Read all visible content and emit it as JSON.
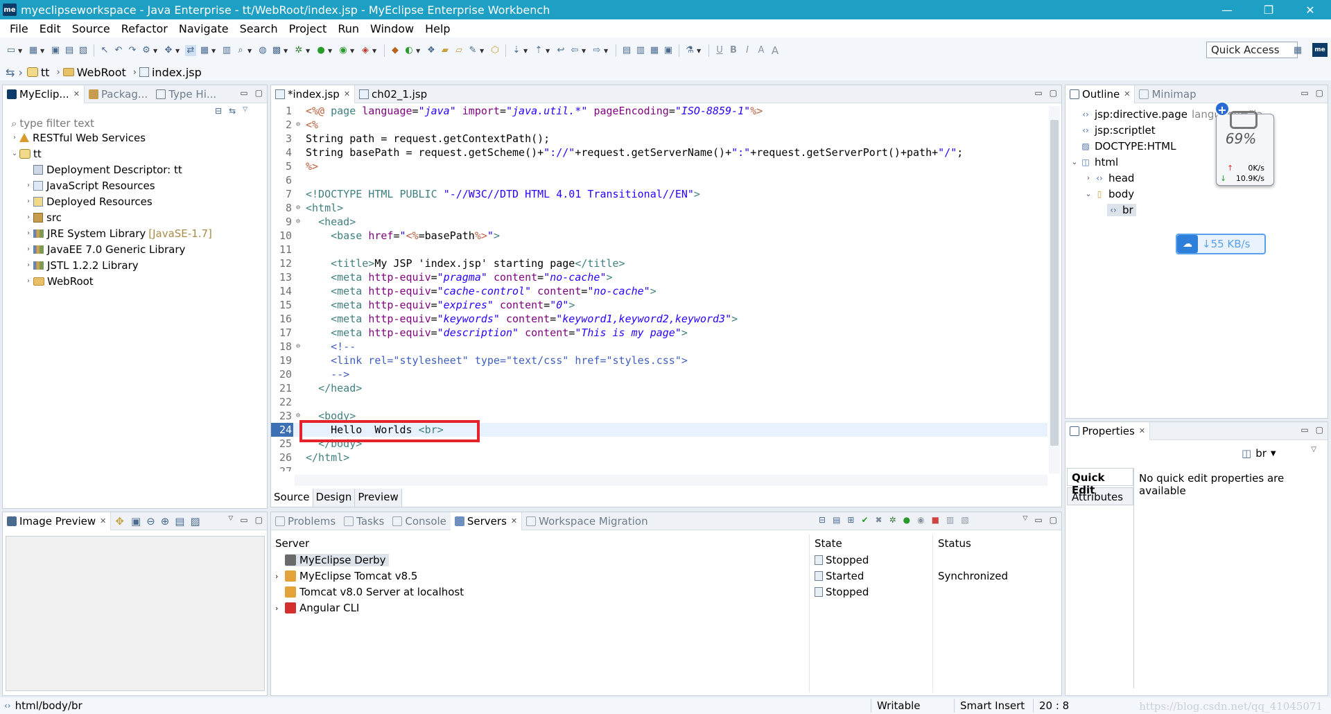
{
  "window": {
    "logo": "me",
    "title": "myeclipseworkspace - Java Enterprise - tt/WebRoot/index.jsp - MyEclipse Enterprise Workbench",
    "minimize": "—",
    "maximize": "❐",
    "close": "✕"
  },
  "menu": [
    "File",
    "Edit",
    "Source",
    "Refactor",
    "Navigate",
    "Search",
    "Project",
    "Run",
    "Window",
    "Help"
  ],
  "toolbar": {
    "quick_access": "Quick Access",
    "perspective": "me",
    "format_letters": [
      "U",
      "B",
      "I",
      "A",
      "A"
    ]
  },
  "breadcrumb": {
    "items": [
      "tt",
      "WebRoot",
      "index.jsp"
    ]
  },
  "explorer": {
    "tabs": [
      "MyEclip...",
      "Packag...",
      "Type Hi..."
    ],
    "filter_placeholder": "type filter text",
    "tree": [
      {
        "label": "RESTful Web Services",
        "icon": "warning-icon",
        "depth": 0,
        "expanded": false
      },
      {
        "label": "tt",
        "icon": "project-icon",
        "depth": 0,
        "expanded": true
      },
      {
        "label": "Deployment Descriptor: tt",
        "icon": "descriptor-icon",
        "depth": 1,
        "expanded": null
      },
      {
        "label": "JavaScript Resources",
        "icon": "js-resources-icon",
        "depth": 1,
        "expanded": false
      },
      {
        "label": "Deployed Resources",
        "icon": "deployed-icon",
        "depth": 1,
        "expanded": false
      },
      {
        "label": "src",
        "icon": "package-icon",
        "depth": 1,
        "expanded": false
      },
      {
        "label": "JRE System Library",
        "suffix": "[JavaSE-1.7]",
        "icon": "library-icon",
        "depth": 1,
        "expanded": false
      },
      {
        "label": "JavaEE 7.0 Generic Library",
        "icon": "library-icon",
        "depth": 1,
        "expanded": false
      },
      {
        "label": "JSTL 1.2.2 Library",
        "icon": "library-icon",
        "depth": 1,
        "expanded": false
      },
      {
        "label": "WebRoot",
        "icon": "folder-icon",
        "depth": 1,
        "expanded": false
      }
    ]
  },
  "editor": {
    "tabs": [
      "*index.jsp",
      "ch02_1.jsp"
    ],
    "current_line": 24,
    "lines": [
      {
        "n": "1",
        "fold": "",
        "html": "<span class='k-jsp'>&lt;%@</span> <span class='k-tag'>page</span> <span class='k-attr'>language</span>=<span class='k-val'>\"java\"</span> <span class='k-attr'>import</span>=<span class='k-val'>\"java.util.*\"</span> <span class='k-attr'>pageEncoding</span>=<span class='k-val'>\"ISO-8859-1\"</span><span class='k-jsp'>%&gt;</span>"
      },
      {
        "n": "2",
        "fold": "⊖",
        "html": "<span class='k-jsp'>&lt;%</span>"
      },
      {
        "n": "3",
        "fold": "",
        "html": "String path = request.getContextPath();"
      },
      {
        "n": "4",
        "fold": "",
        "html": "String basePath = request.getScheme()+<span class='k-str'>\"://\"</span>+request.getServerName()+<span class='k-str'>\":\"</span>+request.getServerPort()+path+<span class='k-str'>\"/\"</span>;"
      },
      {
        "n": "5",
        "fold": "",
        "html": "<span class='k-jsp'>%&gt;</span>"
      },
      {
        "n": "6",
        "fold": "",
        "html": ""
      },
      {
        "n": "7",
        "fold": "",
        "html": "<span class='k-tag'>&lt;!DOCTYPE HTML PUBLIC</span> <span class='k-str'>\"-//W3C//DTD HTML 4.01 Transitional//EN\"</span><span class='k-tag'>&gt;</span>"
      },
      {
        "n": "8",
        "fold": "⊖",
        "html": "<span class='k-tag'>&lt;html&gt;</span>"
      },
      {
        "n": "9",
        "fold": "⊖",
        "html": "  <span class='k-tag'>&lt;head&gt;</span>"
      },
      {
        "n": "10",
        "fold": "",
        "html": "    <span class='k-tag'>&lt;base</span> <span class='k-attr'>href</span>=<span class='k-str'>\"</span><span class='k-jsp'>&lt;%</span>=basePath<span class='k-jsp'>%&gt;</span><span class='k-str'>\"</span><span class='k-tag'>&gt;</span>"
      },
      {
        "n": "11",
        "fold": "",
        "html": ""
      },
      {
        "n": "12",
        "fold": "",
        "html": "    <span class='k-tag'>&lt;title&gt;</span>My JSP 'index.jsp' starting page<span class='k-tag'>&lt;/title&gt;</span>"
      },
      {
        "n": "13",
        "fold": "",
        "html": "    <span class='k-tag'>&lt;meta</span> <span class='k-attr'>http-equiv</span>=<span class='k-val'>\"pragma\"</span> <span class='k-attr'>content</span>=<span class='k-val'>\"no-cache\"</span><span class='k-tag'>&gt;</span>"
      },
      {
        "n": "14",
        "fold": "",
        "html": "    <span class='k-tag'>&lt;meta</span> <span class='k-attr'>http-equiv</span>=<span class='k-val'>\"cache-control\"</span> <span class='k-attr'>content</span>=<span class='k-val'>\"no-cache\"</span><span class='k-tag'>&gt;</span>"
      },
      {
        "n": "15",
        "fold": "",
        "html": "    <span class='k-tag'>&lt;meta</span> <span class='k-attr'>http-equiv</span>=<span class='k-val'>\"expires\"</span> <span class='k-attr'>content</span>=<span class='k-val'>\"0\"</span><span class='k-tag'>&gt;</span>"
      },
      {
        "n": "16",
        "fold": "",
        "html": "    <span class='k-tag'>&lt;meta</span> <span class='k-attr'>http-equiv</span>=<span class='k-val'>\"keywords\"</span> <span class='k-attr'>content</span>=<span class='k-val'>\"keyword1,keyword2,keyword3\"</span><span class='k-tag'>&gt;</span>"
      },
      {
        "n": "17",
        "fold": "",
        "html": "    <span class='k-tag'>&lt;meta</span> <span class='k-attr'>http-equiv</span>=<span class='k-val'>\"description\"</span> <span class='k-attr'>content</span>=<span class='k-val'>\"This is my page\"</span><span class='k-tag'>&gt;</span>"
      },
      {
        "n": "18",
        "fold": "⊖",
        "html": "    <span class='k-cmt'>&lt;!--</span>"
      },
      {
        "n": "19",
        "fold": "",
        "html": "    <span class='k-cmt'>&lt;link rel=\"stylesheet\" type=\"text/css\" href=\"styles.css\"&gt;</span>"
      },
      {
        "n": "20",
        "fold": "",
        "html": "    <span class='k-cmt'>--&gt;</span>"
      },
      {
        "n": "21",
        "fold": "",
        "html": "  <span class='k-tag'>&lt;/head&gt;</span>"
      },
      {
        "n": "22",
        "fold": "",
        "html": ""
      },
      {
        "n": "23",
        "fold": "⊖",
        "html": "  <span class='k-tag'>&lt;body&gt;</span>"
      },
      {
        "n": "24",
        "fold": "",
        "html": "    Hello  Worlds <span class='k-tag'>&lt;br&gt;</span>"
      },
      {
        "n": "25",
        "fold": "",
        "html": "  <span class='k-tag'>&lt;/body&gt;</span>"
      },
      {
        "n": "26",
        "fold": "",
        "html": "<span class='k-tag'>&lt;/html&gt;</span>"
      },
      {
        "n": "27",
        "fold": "",
        "html": ""
      }
    ],
    "bottom_tabs": [
      "Source",
      "Design",
      "Preview"
    ]
  },
  "outline": {
    "tabs": [
      "Outline",
      "Minimap"
    ],
    "tree": [
      {
        "label": "jsp:directive.page",
        "extra": "language=\"ja",
        "depth": 0,
        "arrow": ""
      },
      {
        "label": "jsp:scriptlet",
        "depth": 0,
        "arrow": ""
      },
      {
        "label": "DOCTYPE:HTML",
        "depth": 0,
        "arrow": ""
      },
      {
        "label": "html",
        "depth": 0,
        "arrow": "⌄"
      },
      {
        "label": "head",
        "depth": 1,
        "arrow": "›"
      },
      {
        "label": "body",
        "depth": 1,
        "arrow": "⌄"
      },
      {
        "label": "br",
        "depth": 2,
        "arrow": "",
        "selected": true
      }
    ]
  },
  "net_widget": {
    "percent": "69%",
    "up": "0K/s",
    "down": "10.9K/s",
    "plus": "+"
  },
  "baidu_widget": {
    "speed": "55 KB/s"
  },
  "properties": {
    "tab": "Properties",
    "selected": "br",
    "side_tabs": [
      "Quick Edit",
      "Attributes"
    ],
    "message": "No quick edit properties are available"
  },
  "image_preview": {
    "tab": "Image Preview"
  },
  "servers": {
    "tabs": [
      "Problems",
      "Tasks",
      "Console",
      "Servers",
      "Workspace Migration"
    ],
    "headers": {
      "server": "Server",
      "state": "State",
      "status": "Status"
    },
    "rows": [
      {
        "name": "MyEclipse Derby",
        "state": "Stopped",
        "status": "",
        "expandable": false,
        "selected": true
      },
      {
        "name": "MyEclipse Tomcat v8.5",
        "state": "Started",
        "status": "Synchronized",
        "expandable": true,
        "selected": false
      },
      {
        "name": "Tomcat v8.0 Server at localhost",
        "state": "Stopped",
        "status": "",
        "expandable": false,
        "selected": false
      },
      {
        "name": "Angular CLI",
        "state": "",
        "status": "",
        "expandable": true,
        "selected": false
      }
    ]
  },
  "statusbar": {
    "path": "html/body/br",
    "writable": "Writable",
    "insert_mode": "Smart Insert",
    "position": "20 : 8",
    "watermark": "https://blog.csdn.net/qq_41045071"
  }
}
